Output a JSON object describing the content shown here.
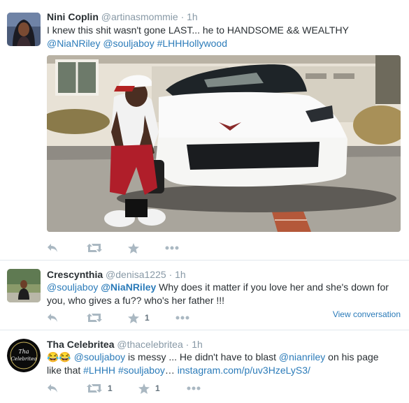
{
  "tweets": [
    {
      "fullname": "Nini Coplin",
      "screen_name": "@artinasmommie",
      "dot": "·",
      "time": "1h",
      "line1": "I knew this shit wasn't  gone LAST... he to HANDSOME && WEALTHY",
      "line2_m1": "@NiaNRiley",
      "line2_m2": "@souljaboy",
      "line2_tag": "#LHHHollywood",
      "reply_icon": "reply-icon",
      "retweet_icon": "retweet-icon",
      "favorite_icon": "star-icon",
      "more_icon": "more-icon"
    },
    {
      "fullname": "Crescynthia",
      "screen_name": "@denisa1225",
      "dot": "·",
      "time": "1h",
      "t_m1": "@souljaboy",
      "t_m2": "@NiaNRiley",
      "t_rest1": " Why does it matter if you love her and she's down for",
      "t_line2": "you, who gives a fu?? who's her father !!!",
      "favorite_count": "1",
      "view_conversation": "View conversation"
    },
    {
      "fullname": "Tha Celebritea",
      "screen_name": "@thacelebritea",
      "dot": "·",
      "time": "1h",
      "emoji": "😂😂",
      "t_m1": "@souljaboy",
      "t_mid": " is messy ... He didn't have to blast ",
      "t_m2": "@nianriley",
      "t_end1": " on his page",
      "t_l2_start": "like that ",
      "t_tag1": "#LHHH",
      "t_tag2": "#souljaboy",
      "t_ellipsis": "…",
      "t_link": "instagram.com/p/uv3HzeLyS3/",
      "retweet_count": "1",
      "favorite_count": "1",
      "avatar_text": "Tha Celebritea"
    }
  ],
  "colors": {
    "link": "#2b7bb9",
    "muted": "#8899a6",
    "icon": "#aab8c2",
    "divider": "#e1e8ed"
  }
}
